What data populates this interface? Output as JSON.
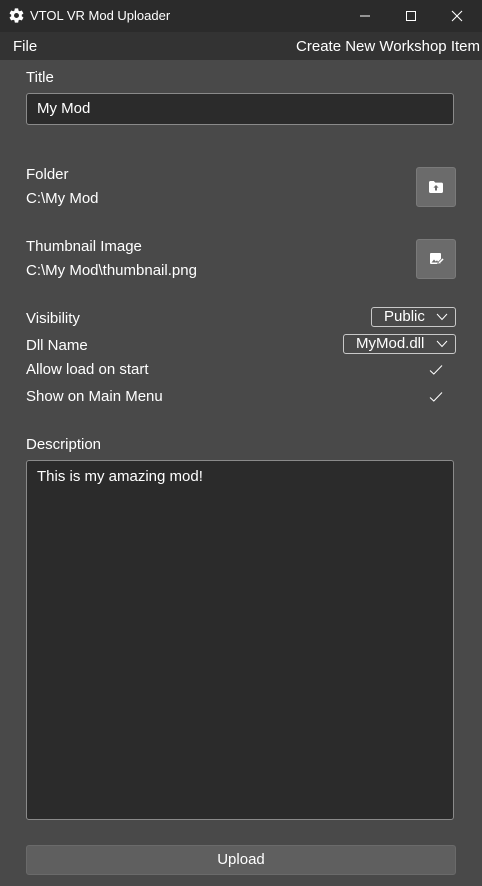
{
  "window": {
    "title": "VTOL VR Mod Uploader",
    "icon": "gear-icon",
    "controls": [
      "minimize-icon",
      "maximize-icon",
      "close-icon"
    ]
  },
  "menu": {
    "file_label": "File",
    "create_label": "Create New Workshop Item"
  },
  "form": {
    "title_label": "Title",
    "title_value": "My Mod",
    "folder_label": "Folder",
    "folder_value": "C:\\My Mod",
    "folder_button_icon": "folder-upload-icon",
    "thumbnail_label": "Thumbnail Image",
    "thumbnail_value": "C:\\My Mod\\thumbnail.png",
    "thumbnail_button_icon": "image-edit-icon",
    "visibility_label": "Visibility",
    "visibility_value": "Public",
    "dll_label": "Dll Name",
    "dll_value": "MyMod.dll",
    "allow_load_label": "Allow load on start",
    "allow_load_checked": true,
    "show_menu_label": "Show on Main Menu",
    "show_menu_checked": true,
    "description_label": "Description",
    "description_value": "This is my amazing mod!",
    "upload_label": "Upload"
  },
  "colors": {
    "background": "#494949",
    "titlebar": "#2b2b2b",
    "menubar": "#333333",
    "input_bg": "#2b2b2b",
    "button_bg": "#6b6b6b",
    "upload_bg": "#5f5f5f",
    "text": "#ffffff"
  }
}
